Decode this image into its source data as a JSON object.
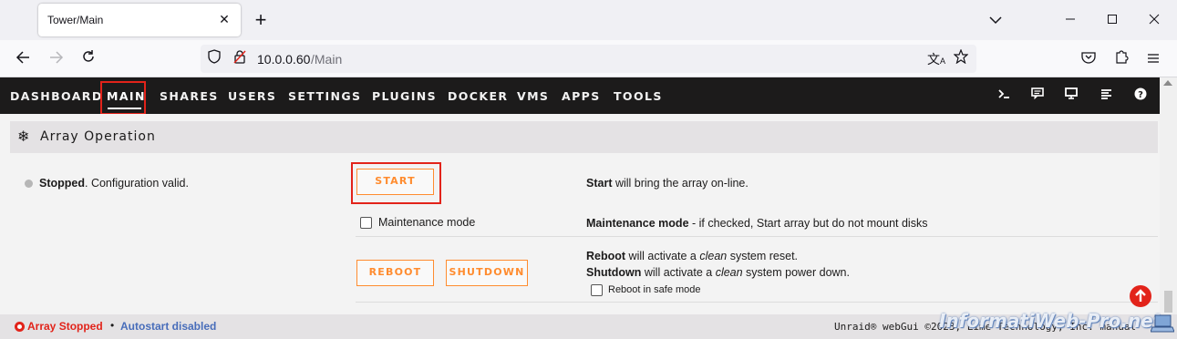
{
  "browser": {
    "tab_title": "Tower/Main",
    "url_host": "10.0.0.60",
    "url_path": "/Main"
  },
  "menu": {
    "items": [
      "DASHBOARD",
      "MAIN",
      "SHARES",
      "USERS",
      "SETTINGS",
      "PLUGINS",
      "DOCKER",
      "VMS",
      "APPS",
      "TOOLS"
    ],
    "active": "MAIN"
  },
  "section": {
    "title": "Array Operation"
  },
  "array_status": {
    "state": "Stopped",
    "detail": ". Configuration valid."
  },
  "buttons": {
    "start": "START",
    "reboot": "REBOOT",
    "shutdown": "SHUTDOWN"
  },
  "descriptions": {
    "start_bold": "Start",
    "start_rest": " will bring the array on-line.",
    "maint_bold": "Maintenance mode",
    "maint_rest": " - if checked, Start array but do not mount disks",
    "reboot_bold": "Reboot",
    "reboot_mid": " will activate a ",
    "reboot_em": "clean",
    "reboot_end": " system reset.",
    "shutdown_bold": "Shutdown",
    "shutdown_mid": " will activate a ",
    "shutdown_em": "clean",
    "shutdown_end": " system power down."
  },
  "checkboxes": {
    "maintenance_label": "Maintenance mode",
    "maintenance_checked": false,
    "safe_mode_label": "Reboot in safe mode",
    "safe_mode_checked": false
  },
  "footer": {
    "array_state": "Array Stopped",
    "separator": "•",
    "autostart": "Autostart disabled",
    "copyright": "Unraid® webGui ©2023, Lime Technology, Inc. manual"
  },
  "watermark": "InformatiWeb-Pro.net",
  "colors": {
    "accent_orange": "#ff8c2f",
    "highlight_red": "#e2231a",
    "menu_bg": "#1c1b1b",
    "link_blue": "#486dba"
  },
  "icons": {
    "section": "snowflake-icon",
    "menu": [
      "terminal-icon",
      "feedback-icon",
      "monitor-icon",
      "log-icon",
      "help-icon"
    ],
    "scroll_top": "arrow-up-circle-icon"
  }
}
